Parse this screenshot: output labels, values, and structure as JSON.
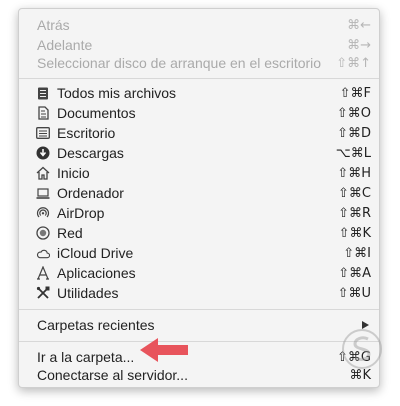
{
  "menu": {
    "items_top": [
      {
        "label": "Atrás",
        "shortcut": "⌘←",
        "disabled": true
      },
      {
        "label": "Adelante",
        "shortcut": "⌘→",
        "disabled": true
      },
      {
        "label": "Seleccionar disco de arranque en el escritorio",
        "shortcut": "⇧⌘↑",
        "disabled": true
      }
    ],
    "places": [
      {
        "label": "Todos mis archivos",
        "shortcut": "⇧⌘F",
        "icon": "all-files-icon"
      },
      {
        "label": "Documentos",
        "shortcut": "⇧⌘O",
        "icon": "documents-icon"
      },
      {
        "label": "Escritorio",
        "shortcut": "⇧⌘D",
        "icon": "desktop-icon"
      },
      {
        "label": "Descargas",
        "shortcut": "⌥⌘L",
        "icon": "downloads-icon"
      },
      {
        "label": "Inicio",
        "shortcut": "⇧⌘H",
        "icon": "home-icon"
      },
      {
        "label": "Ordenador",
        "shortcut": "⇧⌘C",
        "icon": "computer-icon"
      },
      {
        "label": "AirDrop",
        "shortcut": "⇧⌘R",
        "icon": "airdrop-icon"
      },
      {
        "label": "Red",
        "shortcut": "⇧⌘K",
        "icon": "network-icon"
      },
      {
        "label": "iCloud Drive",
        "shortcut": "⇧⌘I",
        "icon": "icloud-icon"
      },
      {
        "label": "Aplicaciones",
        "shortcut": "⇧⌘A",
        "icon": "applications-icon"
      },
      {
        "label": "Utilidades",
        "shortcut": "⇧⌘U",
        "icon": "utilities-icon"
      }
    ],
    "recent": {
      "label": "Carpetas recientes"
    },
    "bottom": [
      {
        "label": "Ir a la carpeta...",
        "shortcut": "⇧⌘G"
      },
      {
        "label": "Conectarse al servidor...",
        "shortcut": "⌘K"
      }
    ]
  },
  "colors": {
    "arrow": "#e8545c",
    "text": "#222222",
    "disabled": "#aaaaaa"
  }
}
